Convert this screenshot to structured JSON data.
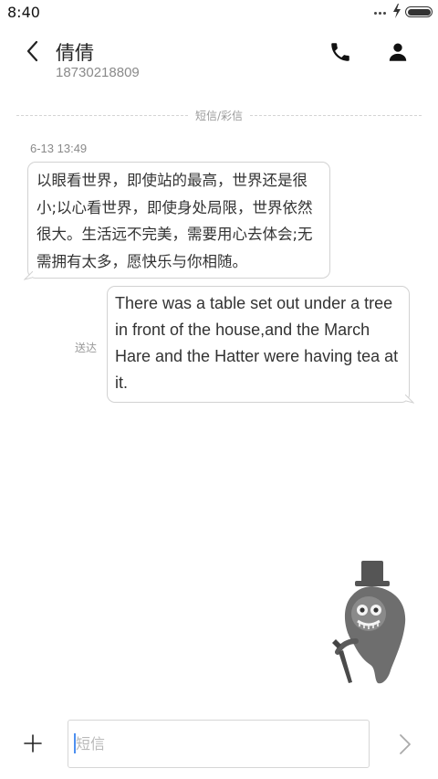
{
  "status_bar": {
    "time": "8:40"
  },
  "header": {
    "contact_name": "倩倩",
    "phone_number": "18730218809"
  },
  "conversation": {
    "channel_label": "短信/彩信",
    "messages": [
      {
        "direction": "incoming",
        "timestamp": "6-13 13:49",
        "lines": [
          "以眼看世界，即使站的最高，世界还是很",
          "小;以心看世界，即使身处局限，世界依然",
          "很大。生活远不完美，需要用心去体会;无",
          "需拥有太多，愿快乐与你相随。"
        ]
      },
      {
        "direction": "outgoing",
        "status": "送达",
        "lines": [
          "There was a table set out under a tree",
          "in front of the house,and the March",
          "Hare and the Hatter were having tea at",
          "it."
        ]
      }
    ]
  },
  "composer": {
    "placeholder": "短信"
  },
  "icons": {
    "back": "chevron-left-icon",
    "call": "phone-icon",
    "contact": "person-icon",
    "attach": "plus-icon",
    "send": "chevron-right-icon"
  }
}
